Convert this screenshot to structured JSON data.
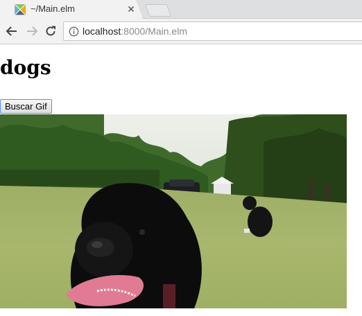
{
  "browser": {
    "tab": {
      "title": "~/Main.elm",
      "favicon": "elm-tangram-icon"
    },
    "toolbar": {
      "back_icon": "back-arrow-icon",
      "forward_icon": "forward-arrow-icon",
      "reload_icon": "reload-icon",
      "info_icon": "info-icon",
      "url_host": "localhost",
      "url_rest": ":8000/Main.elm"
    }
  },
  "page": {
    "heading": "dogs",
    "button_label": "Buscar Gif",
    "gif": {
      "description": "Two black dogs on a lawn"
    }
  },
  "colors": {
    "button_focus_border": "#4d90fe",
    "chrome_bg": "#f2f2f2"
  }
}
